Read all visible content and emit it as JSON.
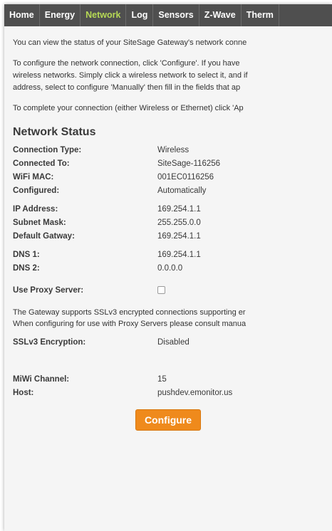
{
  "nav": {
    "items": [
      {
        "label": "Home"
      },
      {
        "label": "Energy"
      },
      {
        "label": "Network"
      },
      {
        "label": "Log"
      },
      {
        "label": "Sensors"
      },
      {
        "label": "Z-Wave"
      },
      {
        "label": "Therm"
      }
    ],
    "active": "Network",
    "active_color": "#b6d955"
  },
  "intro": {
    "p1": "You can view the status of your SiteSage Gateway's network conne",
    "p2_line1": "To configure the network connection, click 'Configure'. If you have",
    "p2_line2": "wireless networks. Simply click a wireless network to select it, and if",
    "p2_line3": "address, select to configure 'Manually' then fill in the fields that ap",
    "p3": "To complete your connection (either Wireless or Ethernet) click 'Ap"
  },
  "status": {
    "title": "Network Status",
    "connection_type": {
      "label": "Connection Type:",
      "value": "Wireless"
    },
    "connected_to": {
      "label": "Connected To:",
      "value": "SiteSage-116256"
    },
    "wifi_mac": {
      "label": "WiFi MAC:",
      "value": "001EC0116256"
    },
    "configured": {
      "label": "Configured:",
      "value": "Automatically"
    },
    "ip_address": {
      "label": "IP Address:",
      "value": "169.254.1.1"
    },
    "subnet_mask": {
      "label": "Subnet Mask:",
      "value": "255.255.0.0"
    },
    "default_gateway": {
      "label": "Default Gatway:",
      "value": "169.254.1.1"
    },
    "dns1": {
      "label": "DNS 1:",
      "value": "169.254.1.1"
    },
    "dns2": {
      "label": "DNS 2:",
      "value": "0.0.0.0"
    },
    "use_proxy": {
      "label": "Use Proxy Server:",
      "checked": false
    }
  },
  "ssl_note": {
    "line1": "The Gateway supports SSLv3 encrypted connections supporting er",
    "line2": "When configuring for use with Proxy Servers please consult manua"
  },
  "ssl": {
    "label": "SSLv3 Encryption:",
    "value": "Disabled"
  },
  "miwi": {
    "label": "MiWi Channel:",
    "value": "15"
  },
  "host": {
    "label": "Host:",
    "value": "pushdev.emonitor.us"
  },
  "configure_button": "Configure",
  "colors": {
    "nav_bg": "#4f4f4f",
    "accent": "#ef8a1c"
  }
}
